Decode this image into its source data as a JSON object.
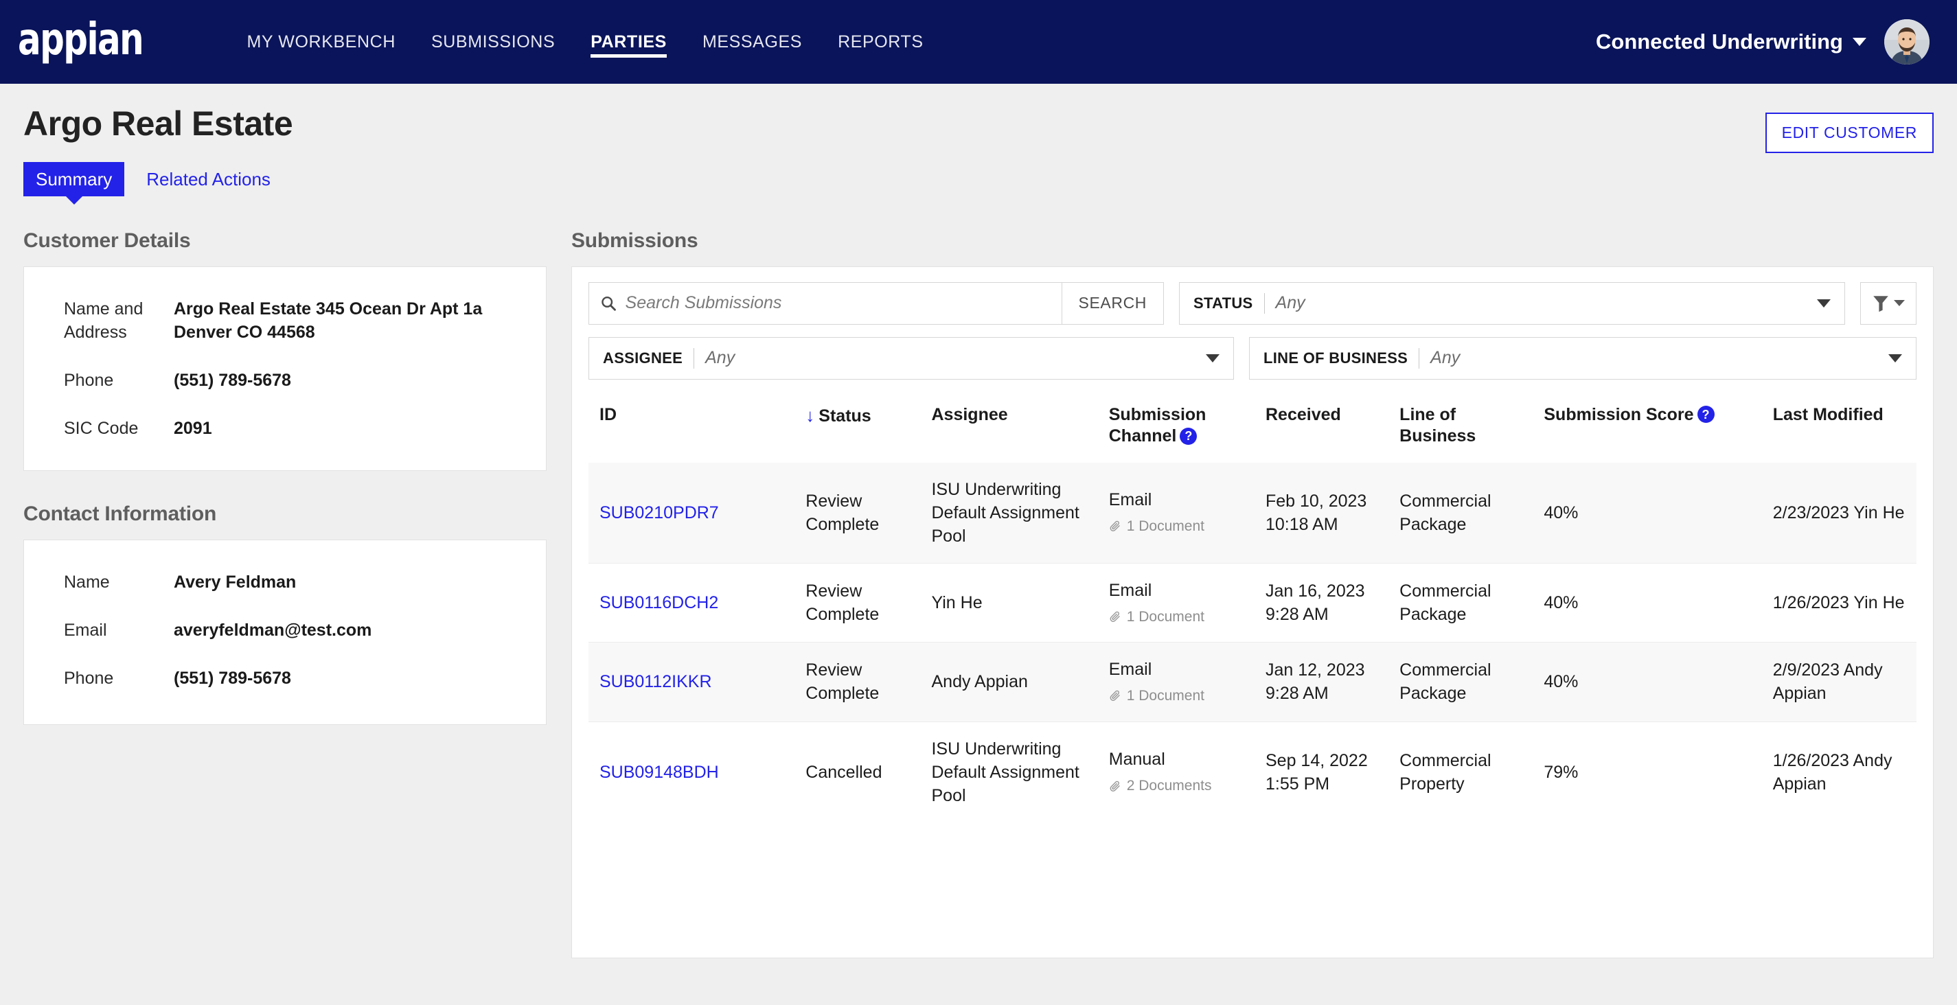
{
  "navbar": {
    "logo_text": "appian",
    "links": [
      {
        "label": "MY WORKBENCH",
        "active": false
      },
      {
        "label": "SUBMISSIONS",
        "active": false
      },
      {
        "label": "PARTIES",
        "active": true
      },
      {
        "label": "MESSAGES",
        "active": false
      },
      {
        "label": "REPORTS",
        "active": false
      }
    ],
    "user_menu_label": "Connected Underwriting",
    "brand_color": "#0a145a"
  },
  "page": {
    "title": "Argo Real Estate",
    "edit_button_label": "EDIT CUSTOMER",
    "accent_color": "#2322e8",
    "tabs": [
      {
        "label": "Summary",
        "active": true
      },
      {
        "label": "Related Actions",
        "active": false
      }
    ]
  },
  "customer_details": {
    "title": "Customer Details",
    "rows": [
      {
        "label": "Name and Address",
        "value": "Argo Real Estate 345 Ocean Dr Apt 1a Denver CO 44568"
      },
      {
        "label": "Phone",
        "value": "(551) 789-5678"
      },
      {
        "label": "SIC Code",
        "value": "2091"
      }
    ]
  },
  "contact_information": {
    "title": "Contact Information",
    "rows": [
      {
        "label": "Name",
        "value": "Avery Feldman"
      },
      {
        "label": "Email",
        "value": "averyfeldman@test.com"
      },
      {
        "label": "Phone",
        "value": "(551) 789-5678"
      }
    ]
  },
  "submissions": {
    "title": "Submissions",
    "search": {
      "placeholder": "Search Submissions",
      "value": "",
      "button_label": "SEARCH"
    },
    "filters": [
      {
        "label": "STATUS",
        "value": "Any"
      },
      {
        "label": "ASSIGNEE",
        "value": "Any"
      },
      {
        "label": "LINE OF BUSINESS",
        "value": "Any"
      }
    ],
    "columns": [
      {
        "key": "id",
        "label": "ID",
        "sorted": false,
        "help": false
      },
      {
        "key": "status",
        "label": "Status",
        "sorted": true,
        "help": false
      },
      {
        "key": "assignee",
        "label": "Assignee",
        "sorted": false,
        "help": false
      },
      {
        "key": "channel",
        "label": "Submission Channel",
        "sorted": false,
        "help": true
      },
      {
        "key": "received",
        "label": "Received",
        "sorted": false,
        "help": false
      },
      {
        "key": "lob",
        "label": "Line of Business",
        "sorted": false,
        "help": false
      },
      {
        "key": "score",
        "label": "Submission Score",
        "sorted": false,
        "help": true
      },
      {
        "key": "modified",
        "label": "Last Modified",
        "sorted": false,
        "help": false
      }
    ],
    "rows": [
      {
        "id": "SUB0210PDR7",
        "status": "Review Complete",
        "assignee": "ISU Underwriting Default Assignment Pool",
        "channel": "Email",
        "documents": "1 Document",
        "received": "Feb 10, 2023 10:18 AM",
        "lob": "Commercial Package",
        "score": "40%",
        "modified": "2/23/2023 Yin He"
      },
      {
        "id": "SUB0116DCH2",
        "status": "Review Complete",
        "assignee": "Yin He",
        "channel": "Email",
        "documents": "1 Document",
        "received": "Jan 16, 2023 9:28 AM",
        "lob": "Commercial Package",
        "score": "40%",
        "modified": "1/26/2023 Yin He"
      },
      {
        "id": "SUB0112IKKR",
        "status": "Review Complete",
        "assignee": "Andy Appian",
        "channel": "Email",
        "documents": "1 Document",
        "received": "Jan 12, 2023 9:28 AM",
        "lob": "Commercial Package",
        "score": "40%",
        "modified": "2/9/2023 Andy Appian"
      },
      {
        "id": "SUB09148BDH",
        "status": "Cancelled",
        "assignee": "ISU Underwriting Default Assignment Pool",
        "channel": "Manual",
        "documents": "2 Documents",
        "received": "Sep 14, 2022 1:55 PM",
        "lob": "Commercial Property",
        "score": "79%",
        "modified": "1/26/2023 Andy Appian"
      }
    ]
  }
}
